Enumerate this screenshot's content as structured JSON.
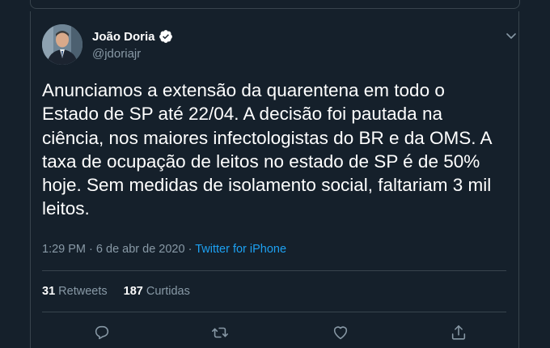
{
  "author": {
    "display_name": "João Doria",
    "handle": "@jdoriajr"
  },
  "tweet": {
    "text": "Anunciamos a extensão da quarentena em todo o\nEstado de SP até 22/04. A decisão foi pautada na\nciência, nos maiores infectologistas do BR e da OMS. A\ntaxa de ocupação de leitos no estado de SP é de 50%\nhoje. Sem medidas de isolamento social, faltariam 3 mil\nleitos.",
    "time": "1:29 PM",
    "separator": "·",
    "date": "6 de abr de 2020",
    "source": "Twitter for iPhone"
  },
  "stats": {
    "retweets_count": "31",
    "retweets_label": "Retweets",
    "likes_count": "187",
    "likes_label": "Curtidas"
  },
  "icons": {
    "reply": "reply-icon",
    "retweet": "retweet-icon",
    "like": "heart-icon",
    "share": "share-icon",
    "verified": "verified-badge-icon",
    "caret": "chevron-down-icon"
  },
  "colors": {
    "background": "#15202b",
    "text_primary": "#ffffff",
    "text_secondary": "#8899a6",
    "link": "#1da1f2",
    "border": "#38444d"
  }
}
